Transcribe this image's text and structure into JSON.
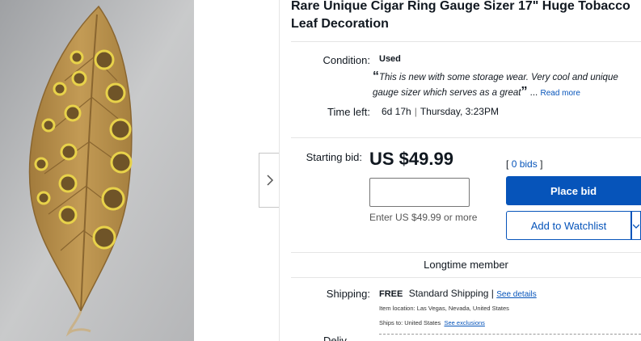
{
  "listing": {
    "title": "Rare Unique Cigar Ring Gauge Sizer 17\" Huge Tobacco Leaf Decoration"
  },
  "condition": {
    "label": "Condition:",
    "value": "Used",
    "open_quote": "“",
    "description": "This is new with some storage wear. Very cool and unique gauge sizer which serves as a great",
    "close_quote": "”",
    "ellipsis": "...",
    "read_more": "Read more"
  },
  "time_left": {
    "label": "Time left:",
    "duration": "6d 17h",
    "separator": "|",
    "end": "Thursday, 3:23PM"
  },
  "bid": {
    "label": "Starting bid:",
    "price": "US $49.99",
    "bids_open": "[",
    "bids_link": "0 bids",
    "bids_close": "]",
    "input_value": "",
    "hint": "Enter US $49.99 or more",
    "place_bid": "Place bid",
    "add_watchlist": "Add to Watchlist"
  },
  "seller": {
    "badge": "Longtime member"
  },
  "shipping": {
    "label": "Shipping:",
    "free": "FREE",
    "method": "Standard Shipping |",
    "see_details": "See details",
    "item_location": "Item location:  Las Vegas, Nevada, United States",
    "ships_to_label": "Ships to:  United States",
    "see_exclusions": "See exclusions"
  },
  "delivery": {
    "label": "Deliv"
  },
  "icons": {
    "next": "chevron-right-icon",
    "dropdown": "chevron-down-icon"
  },
  "colors": {
    "link": "#0654ba",
    "primary_button": "#0654ba",
    "text": "#111820",
    "leaf": "#b8914a",
    "ring": "#e8d24a"
  }
}
